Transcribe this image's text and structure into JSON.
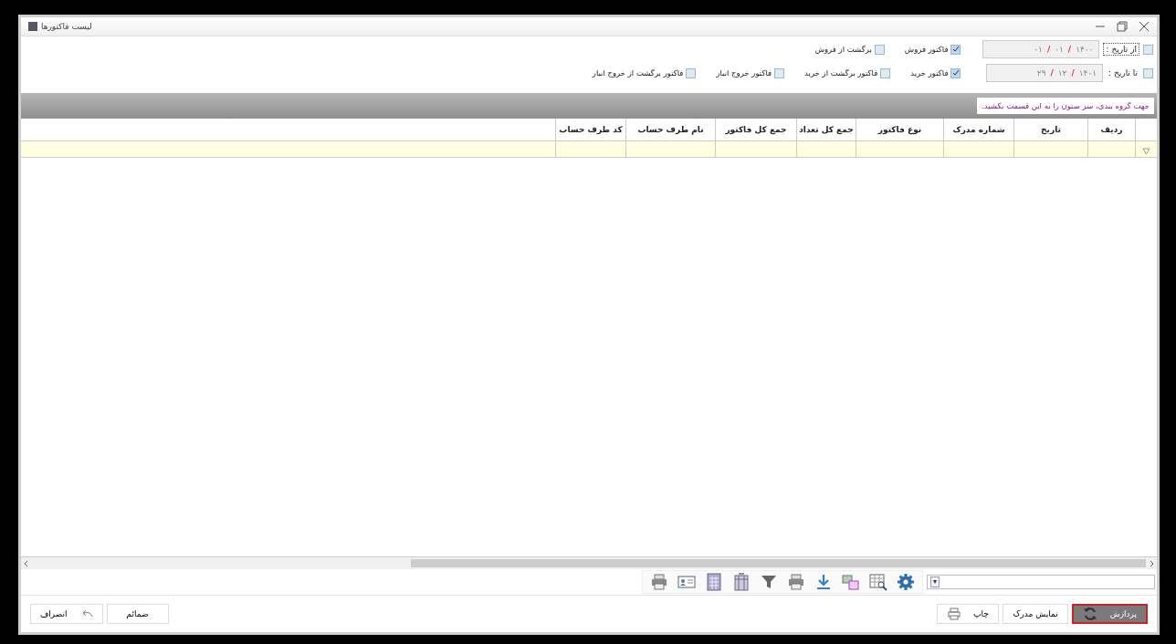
{
  "window": {
    "title": "لیست فاکتورها"
  },
  "date_filters": [
    {
      "label": "از تاریخ :",
      "checked": false,
      "day": "۰۱",
      "month": "۰۱",
      "year": "۱۴۰۰",
      "separator": "/"
    },
    {
      "label": "تا تاریخ :",
      "checked": false,
      "day": "۲۹",
      "month": "۱۲",
      "year": "۱۴۰۱",
      "separator": "/"
    }
  ],
  "invoice_types": [
    [
      {
        "label": "فاکتور فروش",
        "checked": true
      },
      {
        "label": "برگشت از فروش",
        "checked": false
      }
    ],
    [
      {
        "label": "فاکتور خرید",
        "checked": true
      },
      {
        "label": "فاکتور برگشت از خرید",
        "checked": false
      },
      {
        "label": "فاکتور خروج انبار",
        "checked": false
      },
      {
        "label": "فاکتور برگشت از خروج انبار",
        "checked": false
      }
    ]
  ],
  "group_panel": {
    "hint": "جهت گروه بندی، سر ستون را به این قسمت بکشید."
  },
  "table": {
    "columns": [
      "ردیف",
      "تاریخ",
      "شماره مدرک",
      "نوع فاکتور",
      "جمع کل تعداد",
      "جمع کل فاکتور",
      "نام طرف حساب",
      "کد طرف حساب"
    ]
  },
  "buttons_right": [
    {
      "label": "پردازش",
      "kind": "process",
      "selected": true
    },
    {
      "label": "نمایش مدرک",
      "kind": "plain",
      "selected": false
    },
    {
      "label": "چاپ",
      "kind": "print",
      "selected": false
    }
  ],
  "buttons_left": [
    {
      "label": "ضمائم",
      "kind": "plain"
    },
    {
      "label": "انصراف",
      "kind": "undo"
    }
  ]
}
